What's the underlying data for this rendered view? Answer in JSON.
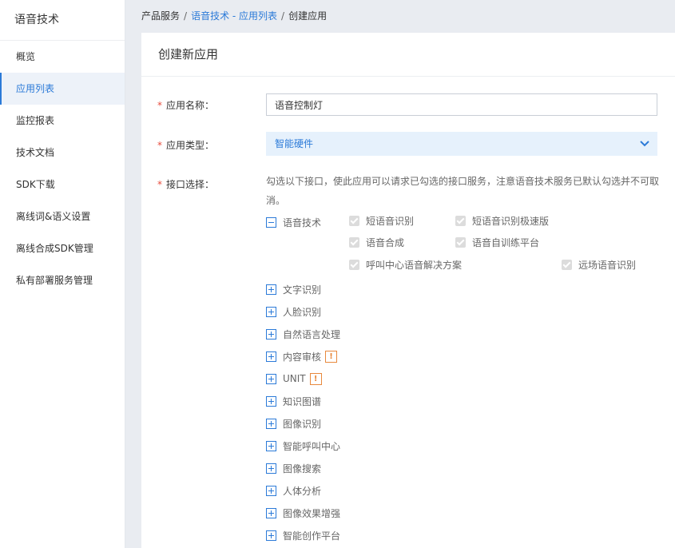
{
  "sidebar": {
    "title": "语音技术",
    "items": [
      {
        "label": "概览"
      },
      {
        "label": "应用列表"
      },
      {
        "label": "监控报表"
      },
      {
        "label": "技术文档"
      },
      {
        "label": "SDK下载"
      },
      {
        "label": "离线词&语义设置"
      },
      {
        "label": "离线合成SDK管理"
      },
      {
        "label": "私有部署服务管理"
      }
    ]
  },
  "breadcrumb": {
    "items": [
      "产品服务",
      "语音技术 - 应用列表",
      "创建应用"
    ],
    "separator": "/"
  },
  "form": {
    "title": "创建新应用",
    "required_mark": "*",
    "name_label": "应用名称：",
    "name_value": "语音控制灯",
    "type_label": "应用类型：",
    "type_value": "智能硬件",
    "api_label": "接口选择：",
    "api_desc": "勾选以下接口，使此应用可以请求已勾选的接口服务，注意语音技术服务已默认勾选并不可取消。",
    "tree": [
      {
        "label": "语音技术",
        "expanded": true,
        "warn": false
      },
      {
        "label": "文字识别",
        "expanded": false,
        "warn": false
      },
      {
        "label": "人脸识别",
        "expanded": false,
        "warn": false
      },
      {
        "label": "自然语言处理",
        "expanded": false,
        "warn": false
      },
      {
        "label": "内容审核",
        "expanded": false,
        "warn": true
      },
      {
        "label": "UNIT",
        "expanded": false,
        "warn": true
      },
      {
        "label": "知识图谱",
        "expanded": false,
        "warn": false
      },
      {
        "label": "图像识别",
        "expanded": false,
        "warn": false
      },
      {
        "label": "智能呼叫中心",
        "expanded": false,
        "warn": false
      },
      {
        "label": "图像搜索",
        "expanded": false,
        "warn": false
      },
      {
        "label": "人体分析",
        "expanded": false,
        "warn": false
      },
      {
        "label": "图像效果增强",
        "expanded": false,
        "warn": false
      },
      {
        "label": "智能创作平台",
        "expanded": false,
        "warn": false
      }
    ],
    "speech_subitems": [
      {
        "label": "短语音识别",
        "checked": true
      },
      {
        "label": "短语音识别极速版",
        "checked": true
      },
      {
        "label": "语音合成",
        "checked": true
      },
      {
        "label": "语音自训练平台",
        "checked": true
      },
      {
        "label": "呼叫中心语音解决方案",
        "checked": true
      },
      {
        "label": "远场语音识别",
        "checked": true
      }
    ],
    "warn_text": "!"
  },
  "colors": {
    "accent": "#2b7ad8",
    "required": "#e74c3c",
    "warning": "#e8893d",
    "select_bg": "#e6f1fc"
  }
}
